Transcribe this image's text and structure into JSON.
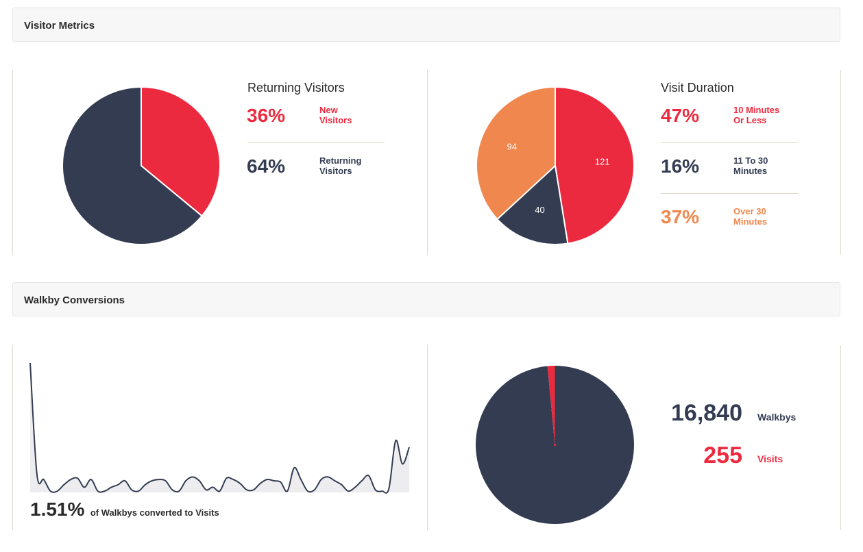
{
  "visitor_metrics": {
    "header": "Visitor Metrics",
    "returning": {
      "title": "Returning Visitors",
      "rows": [
        {
          "pct": "36%",
          "label1": "New",
          "label2": "Visitors"
        },
        {
          "pct": "64%",
          "label1": "Returning",
          "label2": "Visitors"
        }
      ]
    },
    "duration": {
      "title": "Visit Duration",
      "rows": [
        {
          "pct": "47%",
          "label1": "10 Minutes",
          "label2": "Or Less"
        },
        {
          "pct": "16%",
          "label1": "11 To 30",
          "label2": "Minutes"
        },
        {
          "pct": "37%",
          "label1": "Over 30",
          "label2": "Minutes"
        }
      ]
    }
  },
  "walkby": {
    "header": "Walkby Conversions",
    "conversion_pct": "1.51%",
    "conversion_text": "of Walkbys converted to Visits",
    "walkbys_value": "16,840",
    "walkbys_label": "Walkbys",
    "visits_value": "255",
    "visits_label": "Visits"
  },
  "colors": {
    "red": "#ec2a3f",
    "navy": "#343c52",
    "orange": "#f0874e"
  },
  "chart_data": [
    {
      "type": "pie",
      "labels": [
        "New Visitors",
        "Returning Visitors"
      ],
      "values": [
        36,
        64
      ],
      "colors": [
        "#ec2a3f",
        "#343c52"
      ]
    },
    {
      "type": "pie",
      "labels": [
        "10 Minutes Or Less",
        "11 To 30 Minutes",
        "Over 30 Minutes"
      ],
      "values": [
        121,
        40,
        94
      ],
      "colors": [
        "#ec2a3f",
        "#343c52",
        "#f0874e"
      ]
    },
    {
      "type": "area",
      "values": [
        100,
        14,
        10,
        1,
        1,
        6,
        10,
        11,
        4,
        10,
        1,
        1,
        4,
        6,
        9,
        2,
        1,
        6,
        9,
        10,
        9,
        2,
        1,
        9,
        12,
        9,
        2,
        4,
        1,
        11,
        10,
        7,
        2,
        2,
        7,
        10,
        9,
        8,
        1,
        19,
        10,
        1,
        2,
        10,
        12,
        9,
        6,
        1,
        4,
        9,
        13,
        2,
        1,
        3,
        40,
        22,
        35
      ]
    },
    {
      "type": "pie",
      "labels": [
        "Walkbys",
        "Visits"
      ],
      "values": [
        16840,
        255
      ],
      "colors": [
        "#343c52",
        "#ec2a3f"
      ]
    }
  ]
}
